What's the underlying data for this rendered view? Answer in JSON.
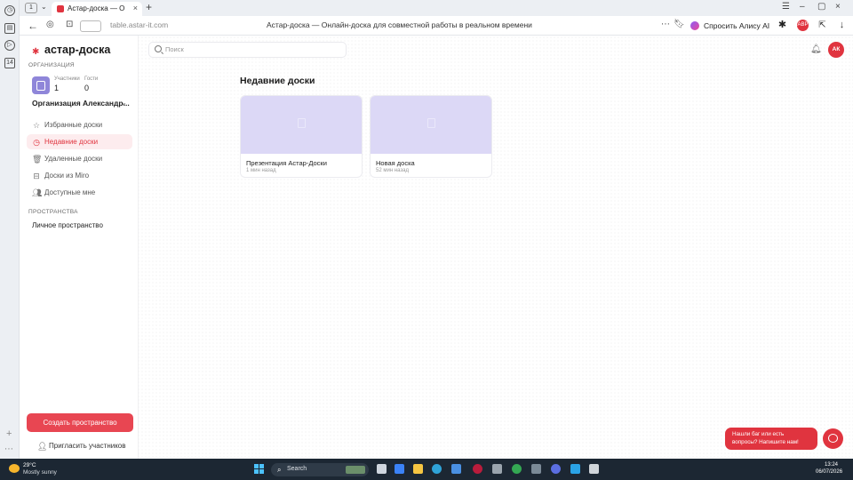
{
  "browser": {
    "tab_count": "1",
    "tab_title": "Астар-доска — Онлай",
    "url": "table.astar-it.com",
    "page_title": "Астар-доска — Онлайн-доска для совместной работы в реальном времени",
    "alice_label": "Спросить Алису AI",
    "left_panel_badge": "14"
  },
  "app": {
    "logo": "астар-доска",
    "org_section": "ОРГАНИЗАЦИЯ",
    "org": {
      "participants_label": "Участники",
      "participants_count": "1",
      "guests_label": "Гости",
      "guests_count": "0",
      "name": "Организация Александр..."
    },
    "nav": [
      {
        "label": "Избранные доски",
        "icon": "star-icon",
        "active": false
      },
      {
        "label": "Недавние доски",
        "icon": "clock-icon",
        "active": true
      },
      {
        "label": "Удаленные доски",
        "icon": "trash-icon",
        "active": false
      },
      {
        "label": "Доски из Miro",
        "icon": "import-icon",
        "active": false
      },
      {
        "label": "Доступные мне",
        "icon": "users-icon",
        "active": false
      }
    ],
    "spaces_section": "ПРОСТРАНСТВА",
    "space_item": "Личное пространство",
    "create_space": "Создать пространство",
    "invite": "Пригласить участников",
    "search_placeholder": "Поиск",
    "avatar_initials": "АК",
    "recent_title": "Недавние доски",
    "boards": [
      {
        "name": "Презентация Астар-Доски",
        "time": "1 мин назад"
      },
      {
        "name": "Новая доска",
        "time": "52 мин назад"
      }
    ],
    "support_text": "Нашли баг или есть вопросы? Напишите нам!"
  },
  "taskbar": {
    "temperature": "29°C",
    "weather": "Mostly sunny",
    "search_label": "Search",
    "time": "13:24",
    "date": "06/07/2026"
  },
  "colors": {
    "accent": "#e0343f",
    "board_thumb": "#dcd8f6",
    "org_avatar": "#8f86d9"
  }
}
